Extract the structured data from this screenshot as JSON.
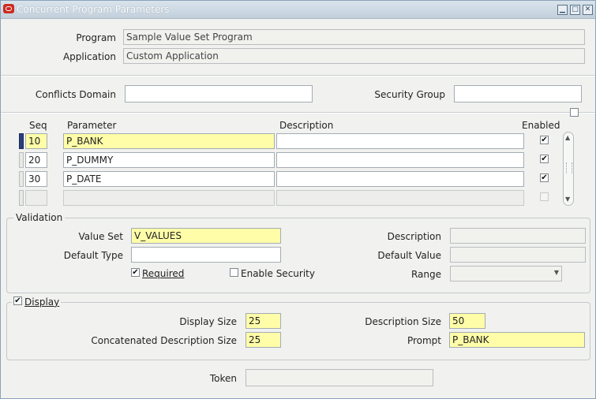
{
  "window": {
    "title": "Concurrent Program Parameters",
    "controls": [
      "minimize-icon",
      "maximize-icon",
      "close-icon"
    ]
  },
  "header": {
    "program_label": "Program",
    "program_value": "Sample Value Set  Program",
    "application_label": "Application",
    "application_value": "Custom Application"
  },
  "security": {
    "conflicts_domain_label": "Conflicts Domain",
    "conflicts_domain_value": "",
    "security_group_label": "Security Group",
    "security_group_value": ""
  },
  "table": {
    "columns": {
      "seq": "Seq",
      "parameter": "Parameter",
      "description": "Description",
      "enabled": "Enabled"
    },
    "rows": [
      {
        "seq": "10",
        "parameter": "P_BANK",
        "description": "",
        "enabled": true,
        "current": true
      },
      {
        "seq": "20",
        "parameter": "P_DUMMY",
        "description": "",
        "enabled": true,
        "current": false
      },
      {
        "seq": "30",
        "parameter": "P_DATE",
        "description": "",
        "enabled": true,
        "current": false
      },
      {
        "seq": "",
        "parameter": "",
        "description": "",
        "enabled": false,
        "current": false
      }
    ]
  },
  "validation": {
    "group_label": "Validation",
    "value_set_label": "Value Set",
    "value_set_value": "V_VALUES",
    "default_type_label": "Default Type",
    "default_type_value": "",
    "required_label": "Required",
    "required_checked": true,
    "enable_security_label": "Enable Security",
    "enable_security_checked": false,
    "description_label": "Description",
    "description_value": "",
    "default_value_label": "Default Value",
    "default_value_value": "",
    "range_label": "Range",
    "range_value": ""
  },
  "display": {
    "group_label": "Display",
    "checked": true,
    "display_size_label": "Display Size",
    "display_size_value": "25",
    "concat_desc_size_label": "Concatenated Description Size",
    "concat_desc_size_value": "25",
    "description_size_label": "Description Size",
    "description_size_value": "50",
    "prompt_label": "Prompt",
    "prompt_value": "P_BANK"
  },
  "token": {
    "label": "Token",
    "value": ""
  },
  "colors": {
    "required_field": "#fffda8",
    "title_bar": "#c9d6e2",
    "current_row_marker": "#2b3e7a",
    "window_background": "#f1f2ef"
  }
}
